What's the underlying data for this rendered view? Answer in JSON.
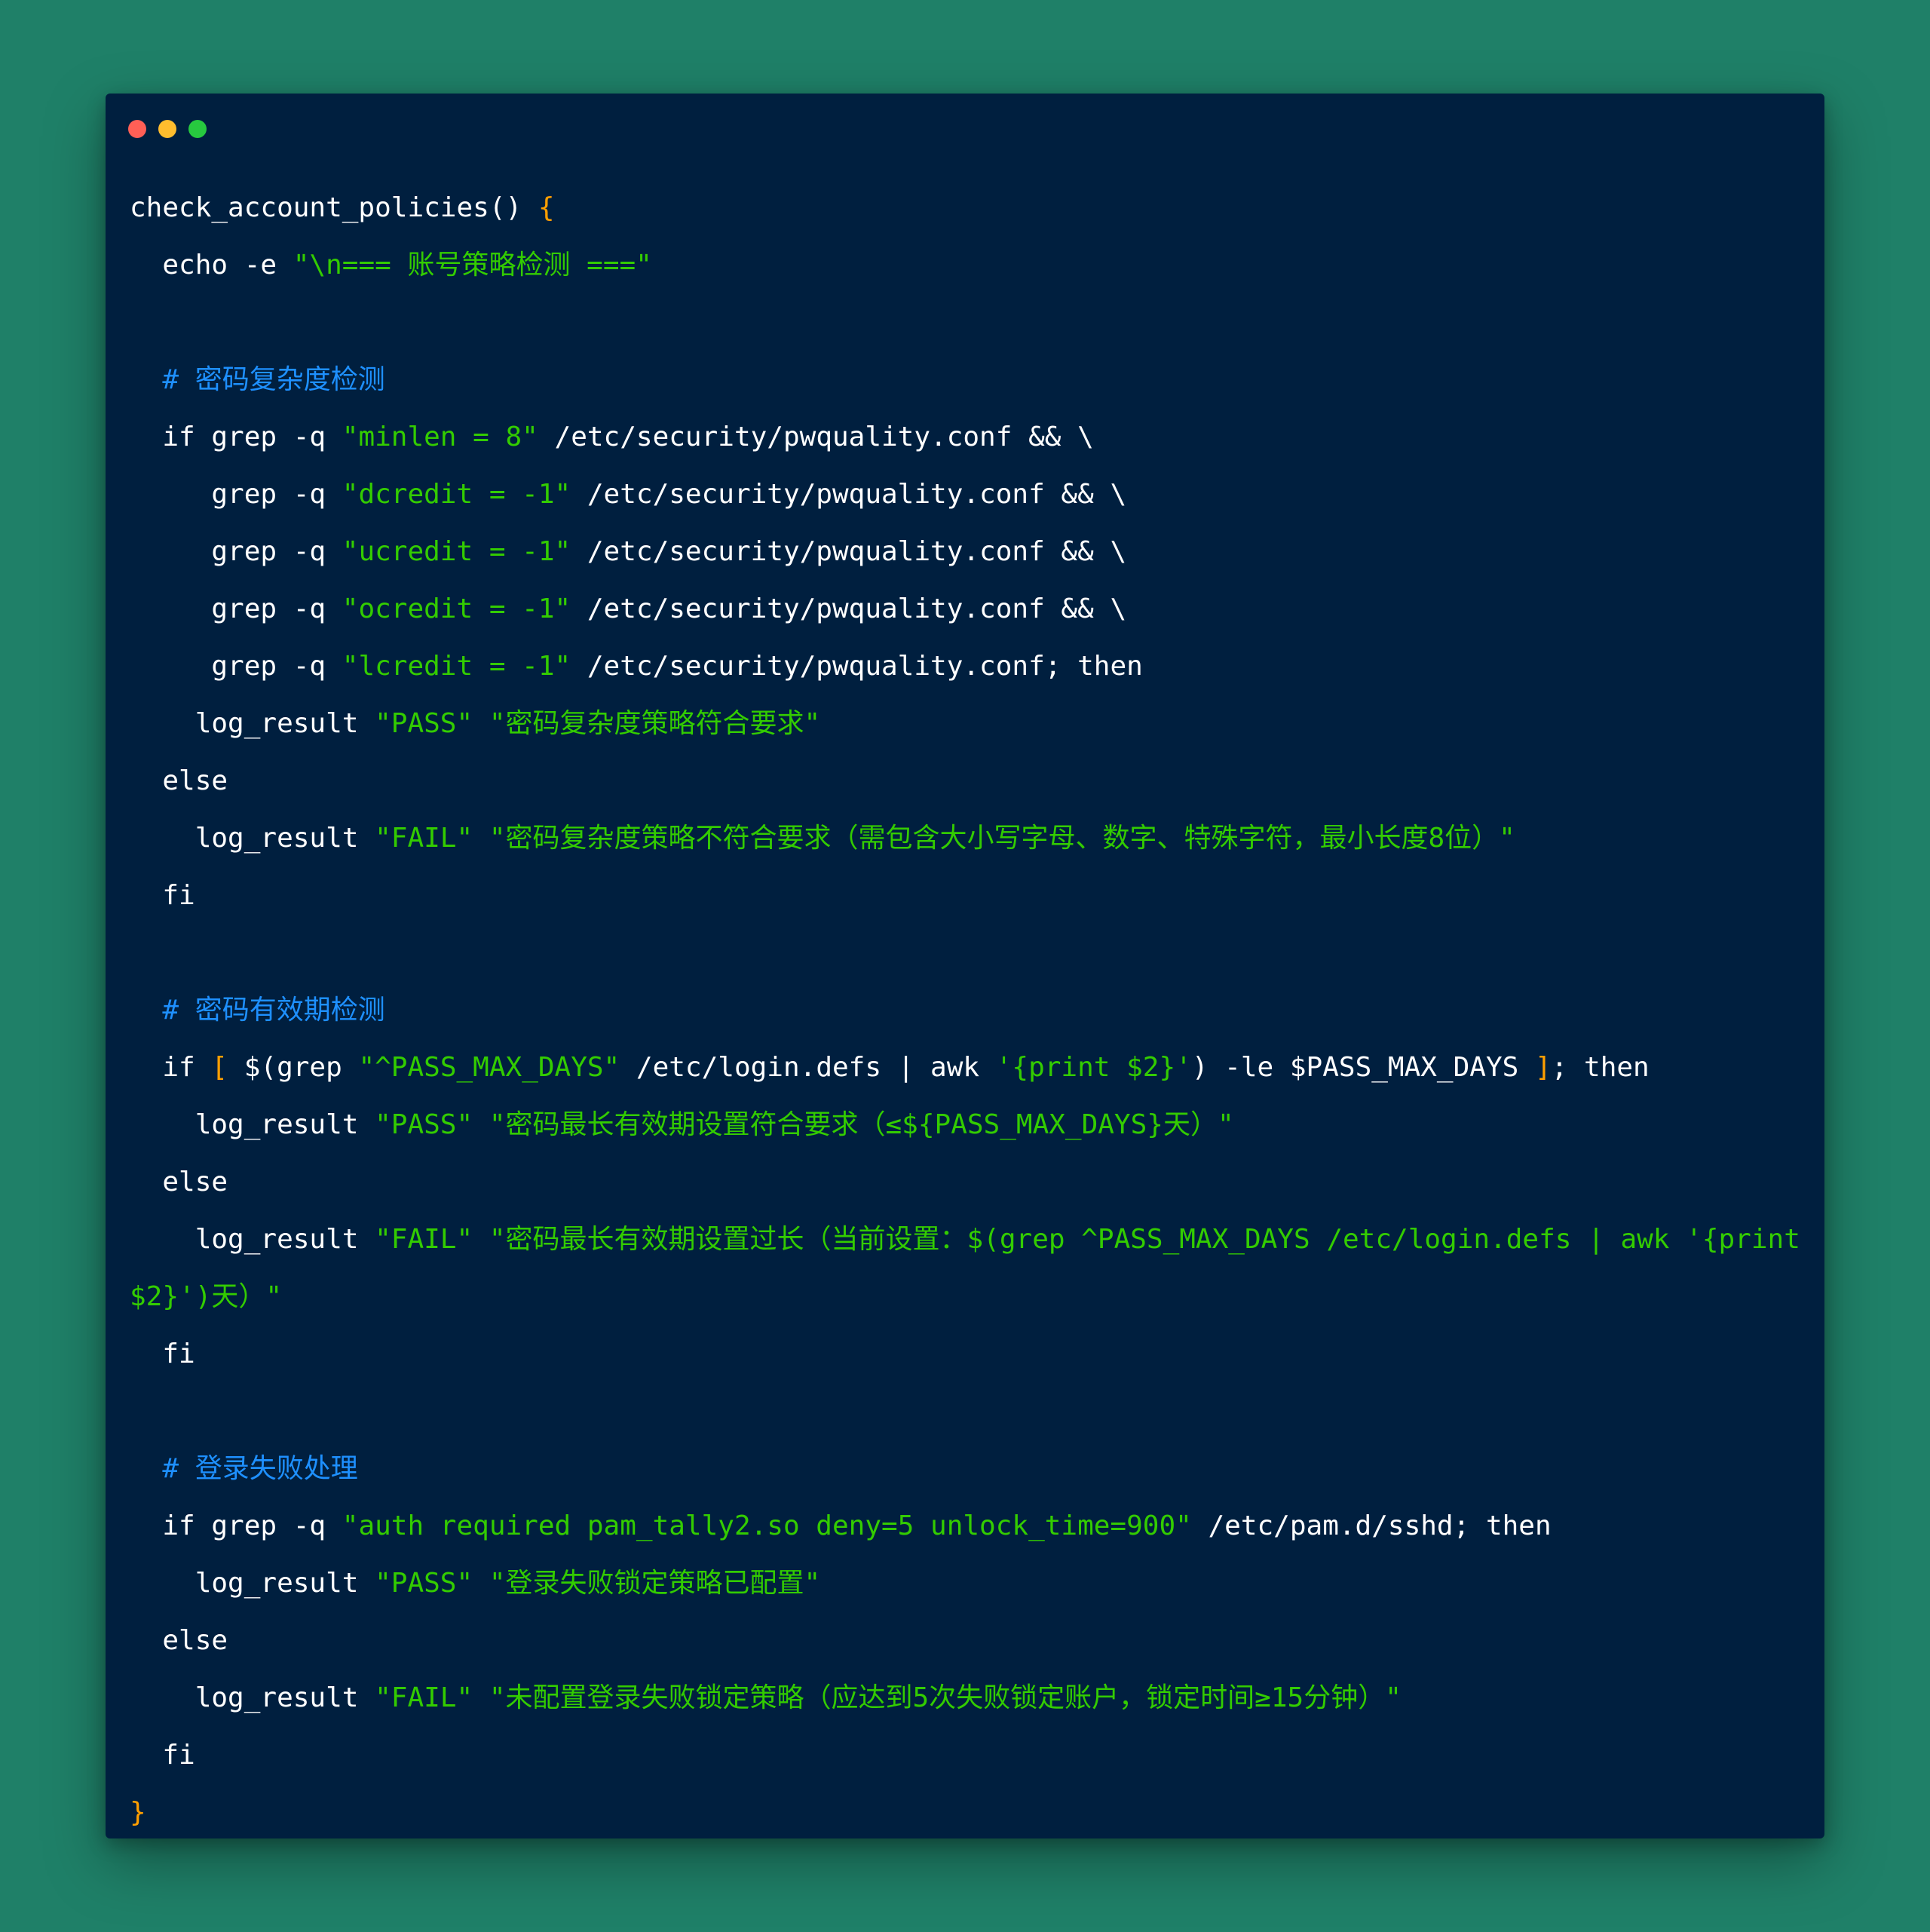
{
  "window": {
    "traffic_lights": [
      {
        "name": "close",
        "color": "#ff5f56"
      },
      {
        "name": "minimize",
        "color": "#ffbd2e"
      },
      {
        "name": "maximize",
        "color": "#27c93f"
      }
    ]
  },
  "colors": {
    "background": "#1f8068",
    "editor": "#001f3f",
    "string": "#33cc00",
    "comment": "#1e90ff",
    "brace": "#ff9f00",
    "plain": "#ffffff"
  },
  "code_lines": [
    [
      {
        "t": "check_account_policies() ",
        "k": "plain"
      },
      {
        "t": "{",
        "k": "brace"
      }
    ],
    [
      {
        "t": "  echo -e ",
        "k": "plain"
      },
      {
        "t": "\"\\n=== 账号策略检测 ===\"",
        "k": "str"
      }
    ],
    [],
    [
      {
        "t": "  # 密码复杂度检测",
        "k": "com"
      }
    ],
    [
      {
        "t": "  if grep -q ",
        "k": "plain"
      },
      {
        "t": "\"minlen = 8\"",
        "k": "str"
      },
      {
        "t": " /etc/security/pwquality.conf && \\",
        "k": "plain"
      }
    ],
    [
      {
        "t": "     grep -q ",
        "k": "plain"
      },
      {
        "t": "\"dcredit = -1\"",
        "k": "str"
      },
      {
        "t": " /etc/security/pwquality.conf && \\",
        "k": "plain"
      }
    ],
    [
      {
        "t": "     grep -q ",
        "k": "plain"
      },
      {
        "t": "\"ucredit = -1\"",
        "k": "str"
      },
      {
        "t": " /etc/security/pwquality.conf && \\",
        "k": "plain"
      }
    ],
    [
      {
        "t": "     grep -q ",
        "k": "plain"
      },
      {
        "t": "\"ocredit = -1\"",
        "k": "str"
      },
      {
        "t": " /etc/security/pwquality.conf && \\",
        "k": "plain"
      }
    ],
    [
      {
        "t": "     grep -q ",
        "k": "plain"
      },
      {
        "t": "\"lcredit = -1\"",
        "k": "str"
      },
      {
        "t": " /etc/security/pwquality.conf; then",
        "k": "plain"
      }
    ],
    [
      {
        "t": "    log_result ",
        "k": "plain"
      },
      {
        "t": "\"PASS\" \"密码复杂度策略符合要求\"",
        "k": "str"
      }
    ],
    [
      {
        "t": "  else",
        "k": "plain"
      }
    ],
    [
      {
        "t": "    log_result ",
        "k": "plain"
      },
      {
        "t": "\"FAIL\" \"密码复杂度策略不符合要求（需包含大小写字母、数字、特殊字符，最小长度8位）\"",
        "k": "str"
      }
    ],
    [
      {
        "t": "  fi",
        "k": "plain"
      }
    ],
    [],
    [
      {
        "t": "  # 密码有效期检测",
        "k": "com"
      }
    ],
    [
      {
        "t": "  if ",
        "k": "plain"
      },
      {
        "t": "[",
        "k": "brace"
      },
      {
        "t": " $(grep ",
        "k": "plain"
      },
      {
        "t": "\"^PASS_MAX_DAYS\"",
        "k": "str"
      },
      {
        "t": " /etc/login.defs | awk ",
        "k": "plain"
      },
      {
        "t": "'{print $2}'",
        "k": "str"
      },
      {
        "t": ") -le $PASS_MAX_DAYS ",
        "k": "plain"
      },
      {
        "t": "]",
        "k": "brace"
      },
      {
        "t": "; then",
        "k": "plain"
      }
    ],
    [
      {
        "t": "    log_result ",
        "k": "plain"
      },
      {
        "t": "\"PASS\" \"密码最长有效期设置符合要求（≤${PASS_MAX_DAYS}天）\"",
        "k": "str"
      }
    ],
    [
      {
        "t": "  else",
        "k": "plain"
      }
    ],
    [
      {
        "t": "    log_result ",
        "k": "plain"
      },
      {
        "t": "\"FAIL\" \"密码最长有效期设置过长（当前设置：$(grep ^PASS_MAX_DAYS /etc/login.defs | awk '{print",
        "k": "str"
      }
    ],
    [
      {
        "t": "$2}')天）\"",
        "k": "str"
      }
    ],
    [
      {
        "t": "  fi",
        "k": "plain"
      }
    ],
    [],
    [
      {
        "t": "  # 登录失败处理",
        "k": "com"
      }
    ],
    [
      {
        "t": "  if grep -q ",
        "k": "plain"
      },
      {
        "t": "\"auth required pam_tally2.so deny=5 unlock_time=900\"",
        "k": "str"
      },
      {
        "t": " /etc/pam.d/sshd; then",
        "k": "plain"
      }
    ],
    [
      {
        "t": "    log_result ",
        "k": "plain"
      },
      {
        "t": "\"PASS\" \"登录失败锁定策略已配置\"",
        "k": "str"
      }
    ],
    [
      {
        "t": "  else",
        "k": "plain"
      }
    ],
    [
      {
        "t": "    log_result ",
        "k": "plain"
      },
      {
        "t": "\"FAIL\" \"未配置登录失败锁定策略（应达到5次失败锁定账户，锁定时间≥15分钟）\"",
        "k": "str"
      }
    ],
    [
      {
        "t": "  fi",
        "k": "plain"
      }
    ],
    [
      {
        "t": "}",
        "k": "brace"
      }
    ]
  ]
}
